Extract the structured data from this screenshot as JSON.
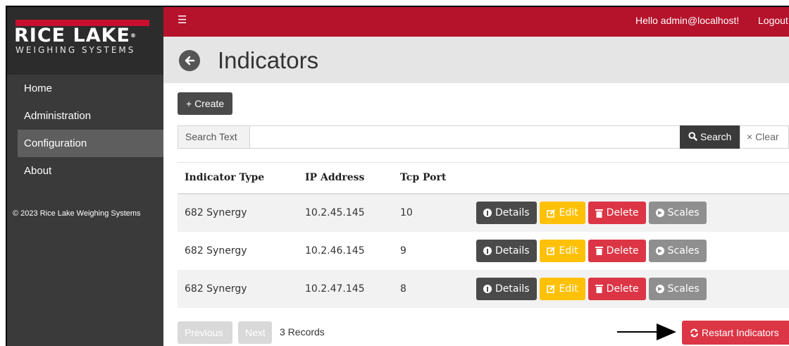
{
  "brand": {
    "name": "RICE LAKE",
    "registered": "®",
    "tagline": "WEIGHING SYSTEMS",
    "red": "#c8102e"
  },
  "header": {
    "menu_icon": "☰",
    "greeting": "Hello admin@localhost!",
    "logout": "Logout",
    "color": "#b5122b"
  },
  "sidebar": {
    "items": [
      {
        "label": "Home"
      },
      {
        "label": "Administration"
      },
      {
        "label": "Configuration",
        "active": true
      },
      {
        "label": "About"
      }
    ],
    "footer": "© 2023 Rice Lake Weighing Systems"
  },
  "page": {
    "title": "Indicators",
    "back_icon": "arrow-left-circle-icon"
  },
  "toolbar": {
    "create_label": "+ Create"
  },
  "search": {
    "label": "Search Text",
    "value": "",
    "search_label": "Search",
    "clear_label": "× Clear"
  },
  "table": {
    "columns": [
      "Indicator Type",
      "IP Address",
      "Tcp Port"
    ],
    "rows": [
      {
        "type": "682 Synergy",
        "ip": "10.2.45.145",
        "port": "10"
      },
      {
        "type": "682 Synergy",
        "ip": "10.2.46.145",
        "port": "9"
      },
      {
        "type": "682 Synergy",
        "ip": "10.2.47.145",
        "port": "8"
      }
    ],
    "actions": {
      "details": "Details",
      "edit": "Edit",
      "delete": "Delete",
      "scales": "Scales"
    }
  },
  "pager": {
    "previous": "Previous",
    "next": "Next",
    "records": "3 Records"
  },
  "restart": {
    "label": "Restart Indicators"
  }
}
